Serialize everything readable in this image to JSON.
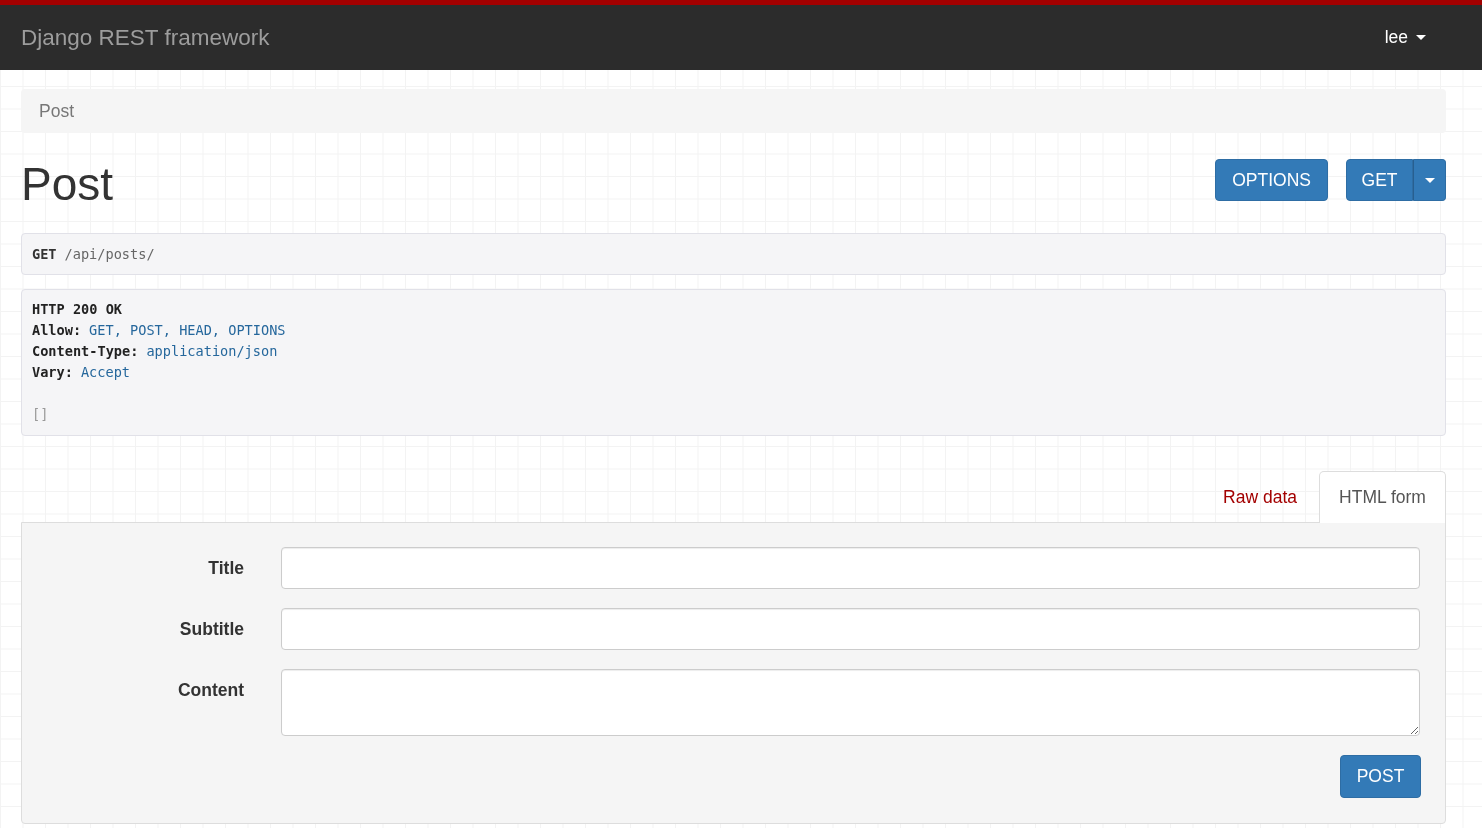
{
  "navbar": {
    "brand": "Django REST framework",
    "user_menu": {
      "label": "lee"
    }
  },
  "breadcrumb": [
    "Post"
  ],
  "page_title": "Post",
  "actions": [
    {
      "label": "OPTIONS",
      "kind": "button"
    },
    {
      "label": "GET",
      "kind": "split"
    }
  ],
  "request": {
    "method": "GET",
    "path": "/api/posts/"
  },
  "response": {
    "status": "HTTP 200 OK",
    "headers": [
      {
        "name": "Allow:",
        "value": "GET, POST, HEAD, OPTIONS"
      },
      {
        "name": "Content-Type:",
        "value": "application/json"
      },
      {
        "name": "Vary:",
        "value": "Accept"
      }
    ],
    "body": "[]"
  },
  "form_tabs": [
    {
      "label": "Raw data",
      "selected": false
    },
    {
      "label": "HTML form",
      "selected": true
    }
  ],
  "form": {
    "fields": [
      {
        "label": "Title",
        "kind": "input"
      },
      {
        "label": "Subtitle",
        "kind": "input"
      },
      {
        "label": "Content",
        "kind": "textarea"
      }
    ],
    "submit": "POST"
  }
}
